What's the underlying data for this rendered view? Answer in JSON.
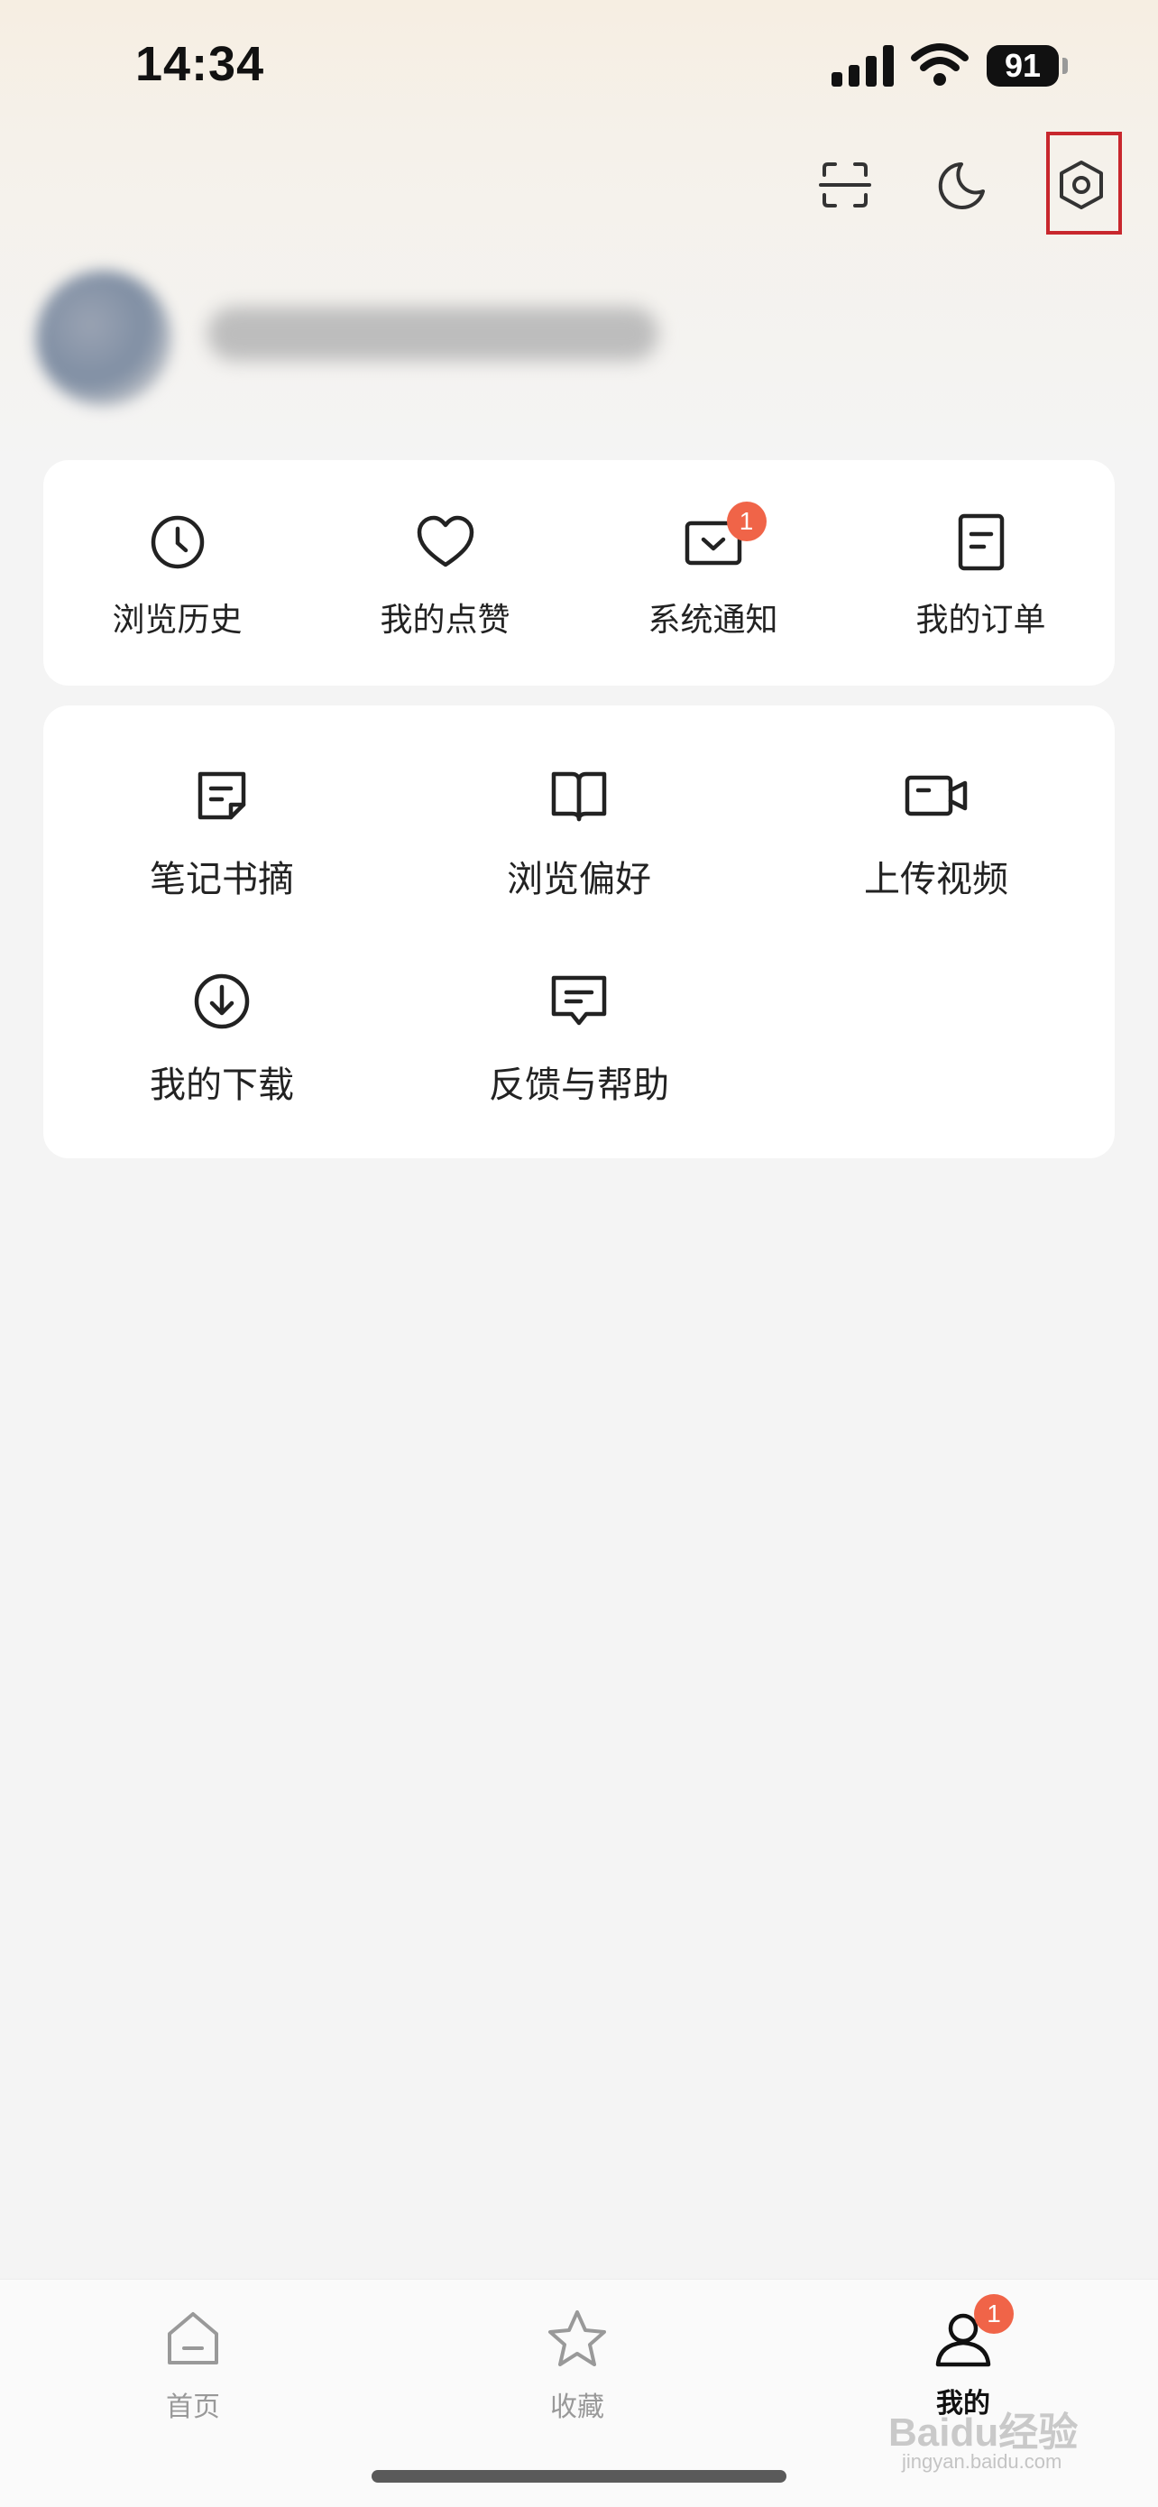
{
  "status_bar": {
    "time": "14:34",
    "battery": "91"
  },
  "top_actions": {
    "scan_icon": "scan-icon",
    "dark_mode_icon": "moon-icon",
    "settings_icon": "settings-icon"
  },
  "quick_links": [
    {
      "label": "浏览历史",
      "icon": "clock-icon"
    },
    {
      "label": "我的点赞",
      "icon": "heart-icon"
    },
    {
      "label": "系统通知",
      "icon": "mail-icon",
      "badge": "1"
    },
    {
      "label": "我的订单",
      "icon": "document-icon"
    }
  ],
  "tools": [
    {
      "label": "笔记书摘",
      "icon": "note-icon"
    },
    {
      "label": "浏览偏好",
      "icon": "book-icon"
    },
    {
      "label": "上传视频",
      "icon": "video-camera-icon"
    },
    {
      "label": "我的下载",
      "icon": "download-icon"
    },
    {
      "label": "反馈与帮助",
      "icon": "feedback-icon"
    }
  ],
  "tabbar": {
    "home": "首页",
    "favorites": "收藏",
    "me": "我的",
    "me_badge": "1",
    "active": "me"
  },
  "watermark": {
    "main": "Baidu经验",
    "sub": "jingyan.baidu.com"
  },
  "colors": {
    "badge": "#f06448",
    "highlight": "#c8272d"
  }
}
